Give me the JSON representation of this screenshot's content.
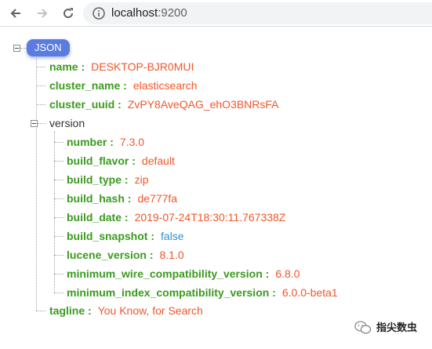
{
  "browser": {
    "url_host": "localhost",
    "url_port": ":9200"
  },
  "viewer": {
    "root_label": "JSON",
    "fields": [
      {
        "key": "name",
        "value": "DESKTOP-BJR0MUI"
      },
      {
        "key": "cluster_name",
        "value": "elasticsearch"
      },
      {
        "key": "cluster_uuid",
        "value": "ZvPY8AveQAG_ehO3BNRsFA"
      }
    ],
    "version": {
      "label": "version",
      "fields": [
        {
          "key": "number",
          "value": "7.3.0"
        },
        {
          "key": "build_flavor",
          "value": "default"
        },
        {
          "key": "build_type",
          "value": "zip"
        },
        {
          "key": "build_hash",
          "value": "de777fa"
        },
        {
          "key": "build_date",
          "value": "2019-07-24T18:30:11.767338Z"
        },
        {
          "key": "build_snapshot",
          "value": "false"
        },
        {
          "key": "lucene_version",
          "value": "8.1.0"
        },
        {
          "key": "minimum_wire_compatibility_version",
          "value": "6.8.0"
        },
        {
          "key": "minimum_index_compatibility_version",
          "value": "6.0.0-beta1"
        }
      ]
    },
    "tagline": {
      "key": "tagline",
      "value": "You Know, for Search"
    },
    "key_suffix": " :"
  },
  "watermark": {
    "text": "指尖数虫"
  },
  "colors": {
    "key": "#3a9a1e",
    "string_value": "#f0562a",
    "boolean_value": "#2b93c8",
    "badge": "#5a7ce0"
  }
}
